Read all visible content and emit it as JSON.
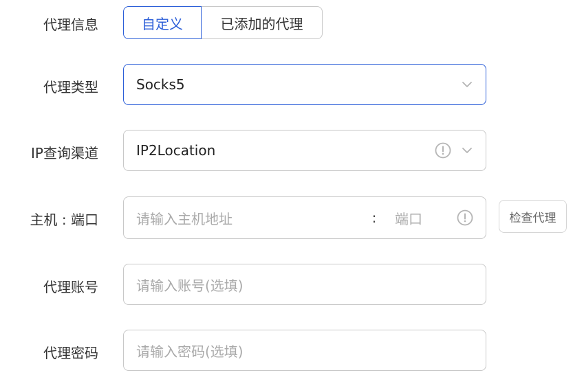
{
  "proxy_info": {
    "label": "代理信息",
    "tabs": [
      {
        "label": "自定义",
        "active": true
      },
      {
        "label": "已添加的代理",
        "active": false
      }
    ]
  },
  "proxy_type": {
    "label": "代理类型",
    "value": "Socks5"
  },
  "ip_channel": {
    "label": "IP查询渠道",
    "value": "IP2Location"
  },
  "host_port": {
    "label": "主机 : 端口",
    "host_placeholder": "请输入主机地址",
    "separator": ":",
    "port_placeholder": "端口",
    "check_button": "检查代理"
  },
  "account": {
    "label": "代理账号",
    "placeholder": "请输入账号(选填)"
  },
  "password": {
    "label": "代理密码",
    "placeholder": "请输入密码(选填)"
  },
  "colors": {
    "accent": "#2b5ed8",
    "border": "#c8c8c8",
    "placeholder": "#aaaaaa"
  }
}
